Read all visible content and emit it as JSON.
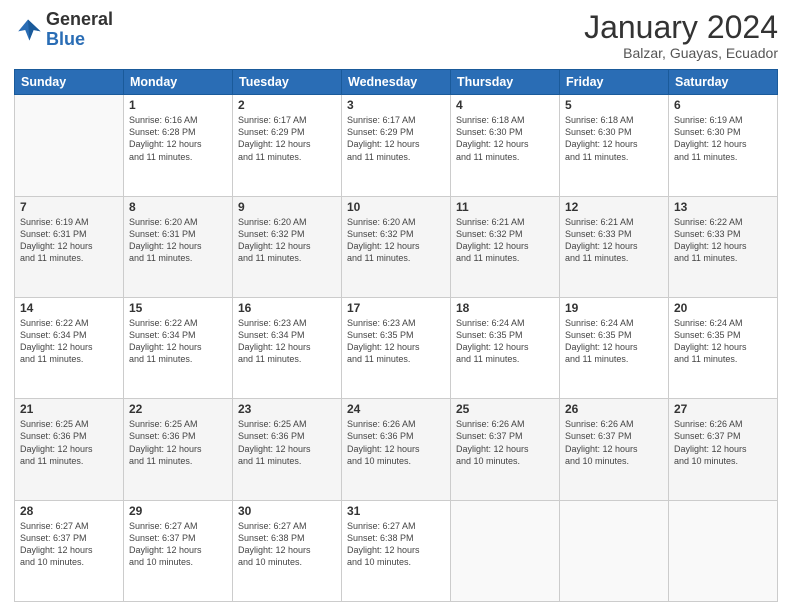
{
  "logo": {
    "general": "General",
    "blue": "Blue"
  },
  "header": {
    "month": "January 2024",
    "location": "Balzar, Guayas, Ecuador"
  },
  "weekdays": [
    "Sunday",
    "Monday",
    "Tuesday",
    "Wednesday",
    "Thursday",
    "Friday",
    "Saturday"
  ],
  "weeks": [
    [
      {
        "day": "",
        "info": ""
      },
      {
        "day": "1",
        "info": "Sunrise: 6:16 AM\nSunset: 6:28 PM\nDaylight: 12 hours\nand 11 minutes."
      },
      {
        "day": "2",
        "info": "Sunrise: 6:17 AM\nSunset: 6:29 PM\nDaylight: 12 hours\nand 11 minutes."
      },
      {
        "day": "3",
        "info": "Sunrise: 6:17 AM\nSunset: 6:29 PM\nDaylight: 12 hours\nand 11 minutes."
      },
      {
        "day": "4",
        "info": "Sunrise: 6:18 AM\nSunset: 6:30 PM\nDaylight: 12 hours\nand 11 minutes."
      },
      {
        "day": "5",
        "info": "Sunrise: 6:18 AM\nSunset: 6:30 PM\nDaylight: 12 hours\nand 11 minutes."
      },
      {
        "day": "6",
        "info": "Sunrise: 6:19 AM\nSunset: 6:30 PM\nDaylight: 12 hours\nand 11 minutes."
      }
    ],
    [
      {
        "day": "7",
        "info": "Sunrise: 6:19 AM\nSunset: 6:31 PM\nDaylight: 12 hours\nand 11 minutes."
      },
      {
        "day": "8",
        "info": "Sunrise: 6:20 AM\nSunset: 6:31 PM\nDaylight: 12 hours\nand 11 minutes."
      },
      {
        "day": "9",
        "info": "Sunrise: 6:20 AM\nSunset: 6:32 PM\nDaylight: 12 hours\nand 11 minutes."
      },
      {
        "day": "10",
        "info": "Sunrise: 6:20 AM\nSunset: 6:32 PM\nDaylight: 12 hours\nand 11 minutes."
      },
      {
        "day": "11",
        "info": "Sunrise: 6:21 AM\nSunset: 6:32 PM\nDaylight: 12 hours\nand 11 minutes."
      },
      {
        "day": "12",
        "info": "Sunrise: 6:21 AM\nSunset: 6:33 PM\nDaylight: 12 hours\nand 11 minutes."
      },
      {
        "day": "13",
        "info": "Sunrise: 6:22 AM\nSunset: 6:33 PM\nDaylight: 12 hours\nand 11 minutes."
      }
    ],
    [
      {
        "day": "14",
        "info": "Sunrise: 6:22 AM\nSunset: 6:34 PM\nDaylight: 12 hours\nand 11 minutes."
      },
      {
        "day": "15",
        "info": "Sunrise: 6:22 AM\nSunset: 6:34 PM\nDaylight: 12 hours\nand 11 minutes."
      },
      {
        "day": "16",
        "info": "Sunrise: 6:23 AM\nSunset: 6:34 PM\nDaylight: 12 hours\nand 11 minutes."
      },
      {
        "day": "17",
        "info": "Sunrise: 6:23 AM\nSunset: 6:35 PM\nDaylight: 12 hours\nand 11 minutes."
      },
      {
        "day": "18",
        "info": "Sunrise: 6:24 AM\nSunset: 6:35 PM\nDaylight: 12 hours\nand 11 minutes."
      },
      {
        "day": "19",
        "info": "Sunrise: 6:24 AM\nSunset: 6:35 PM\nDaylight: 12 hours\nand 11 minutes."
      },
      {
        "day": "20",
        "info": "Sunrise: 6:24 AM\nSunset: 6:35 PM\nDaylight: 12 hours\nand 11 minutes."
      }
    ],
    [
      {
        "day": "21",
        "info": "Sunrise: 6:25 AM\nSunset: 6:36 PM\nDaylight: 12 hours\nand 11 minutes."
      },
      {
        "day": "22",
        "info": "Sunrise: 6:25 AM\nSunset: 6:36 PM\nDaylight: 12 hours\nand 11 minutes."
      },
      {
        "day": "23",
        "info": "Sunrise: 6:25 AM\nSunset: 6:36 PM\nDaylight: 12 hours\nand 11 minutes."
      },
      {
        "day": "24",
        "info": "Sunrise: 6:26 AM\nSunset: 6:36 PM\nDaylight: 12 hours\nand 10 minutes."
      },
      {
        "day": "25",
        "info": "Sunrise: 6:26 AM\nSunset: 6:37 PM\nDaylight: 12 hours\nand 10 minutes."
      },
      {
        "day": "26",
        "info": "Sunrise: 6:26 AM\nSunset: 6:37 PM\nDaylight: 12 hours\nand 10 minutes."
      },
      {
        "day": "27",
        "info": "Sunrise: 6:26 AM\nSunset: 6:37 PM\nDaylight: 12 hours\nand 10 minutes."
      }
    ],
    [
      {
        "day": "28",
        "info": "Sunrise: 6:27 AM\nSunset: 6:37 PM\nDaylight: 12 hours\nand 10 minutes."
      },
      {
        "day": "29",
        "info": "Sunrise: 6:27 AM\nSunset: 6:37 PM\nDaylight: 12 hours\nand 10 minutes."
      },
      {
        "day": "30",
        "info": "Sunrise: 6:27 AM\nSunset: 6:38 PM\nDaylight: 12 hours\nand 10 minutes."
      },
      {
        "day": "31",
        "info": "Sunrise: 6:27 AM\nSunset: 6:38 PM\nDaylight: 12 hours\nand 10 minutes."
      },
      {
        "day": "",
        "info": ""
      },
      {
        "day": "",
        "info": ""
      },
      {
        "day": "",
        "info": ""
      }
    ]
  ]
}
